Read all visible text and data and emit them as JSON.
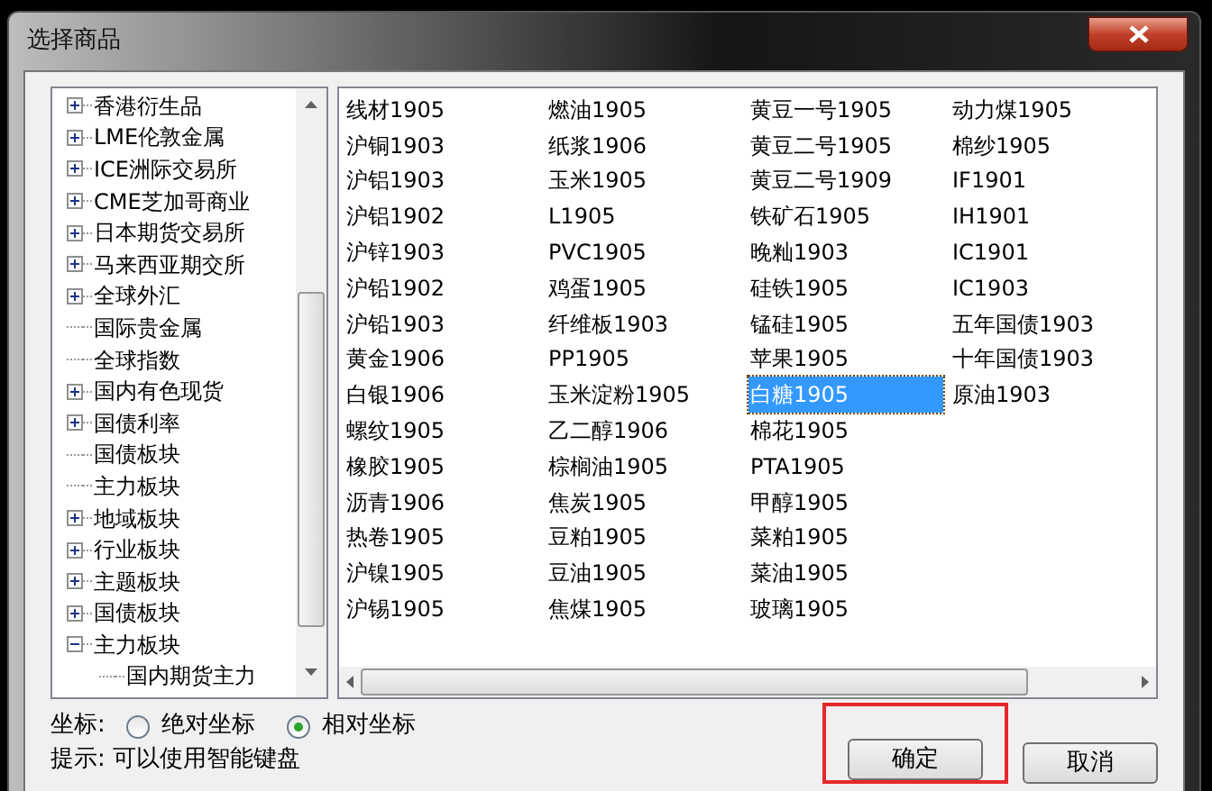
{
  "window": {
    "title": "选择商品"
  },
  "tree": [
    {
      "label": "香港衍生品",
      "kind": "group",
      "expanded": false
    },
    {
      "label": "LME伦敦金属",
      "kind": "group",
      "expanded": false
    },
    {
      "label": "ICE洲际交易所",
      "kind": "group",
      "expanded": false
    },
    {
      "label": "CME芝加哥商业",
      "kind": "group",
      "expanded": false
    },
    {
      "label": "日本期货交易所",
      "kind": "group",
      "expanded": false
    },
    {
      "label": "马来西亚期交所",
      "kind": "group",
      "expanded": false
    },
    {
      "label": "全球外汇",
      "kind": "group",
      "expanded": false
    },
    {
      "label": "国际贵金属",
      "kind": "leaf"
    },
    {
      "label": "全球指数",
      "kind": "leaf"
    },
    {
      "label": "国内有色现货",
      "kind": "group",
      "expanded": false
    },
    {
      "label": "国债利率",
      "kind": "group",
      "expanded": false
    },
    {
      "label": "国债板块",
      "kind": "leaf"
    },
    {
      "label": "主力板块",
      "kind": "leaf"
    },
    {
      "label": "地域板块",
      "kind": "group",
      "expanded": false
    },
    {
      "label": "行业板块",
      "kind": "group",
      "expanded": false
    },
    {
      "label": "主题板块",
      "kind": "group",
      "expanded": false
    },
    {
      "label": "国债板块",
      "kind": "group",
      "expanded": false
    },
    {
      "label": "主力板块",
      "kind": "group",
      "expanded": true,
      "children": [
        {
          "label": "国内期货主力",
          "kind": "leaf"
        }
      ]
    }
  ],
  "products": [
    [
      {
        "label": "线材1905",
        "selected": false
      },
      {
        "label": "沪铜1903",
        "selected": false
      },
      {
        "label": "沪铝1903",
        "selected": false
      },
      {
        "label": "沪铝1902",
        "selected": false
      },
      {
        "label": "沪锌1903",
        "selected": false
      },
      {
        "label": "沪铅1902",
        "selected": false
      },
      {
        "label": "沪铅1903",
        "selected": false
      },
      {
        "label": "黄金1906",
        "selected": false
      },
      {
        "label": "白银1906",
        "selected": false
      },
      {
        "label": "螺纹1905",
        "selected": false
      },
      {
        "label": "橡胶1905",
        "selected": false
      },
      {
        "label": "沥青1906",
        "selected": false
      },
      {
        "label": "热卷1905",
        "selected": false
      },
      {
        "label": "沪镍1905",
        "selected": false
      },
      {
        "label": "沪锡1905",
        "selected": false
      }
    ],
    [
      {
        "label": "燃油1905",
        "selected": false
      },
      {
        "label": "纸浆1906",
        "selected": false
      },
      {
        "label": "玉米1905",
        "selected": false
      },
      {
        "label": "L1905",
        "selected": false
      },
      {
        "label": "PVC1905",
        "selected": false
      },
      {
        "label": "鸡蛋1905",
        "selected": false
      },
      {
        "label": "纤维板1903",
        "selected": false
      },
      {
        "label": "PP1905",
        "selected": false
      },
      {
        "label": "玉米淀粉1905",
        "selected": false
      },
      {
        "label": "乙二醇1906",
        "selected": false
      },
      {
        "label": "棕榈油1905",
        "selected": false
      },
      {
        "label": "焦炭1905",
        "selected": false
      },
      {
        "label": "豆粕1905",
        "selected": false
      },
      {
        "label": "豆油1905",
        "selected": false
      },
      {
        "label": "焦煤1905",
        "selected": false
      }
    ],
    [
      {
        "label": "黄豆一号1905",
        "selected": false
      },
      {
        "label": "黄豆二号1905",
        "selected": false
      },
      {
        "label": "黄豆二号1909",
        "selected": false
      },
      {
        "label": "铁矿石1905",
        "selected": false
      },
      {
        "label": "晚籼1903",
        "selected": false
      },
      {
        "label": "硅铁1905",
        "selected": false
      },
      {
        "label": "锰硅1905",
        "selected": false
      },
      {
        "label": "苹果1905",
        "selected": false
      },
      {
        "label": "白糖1905",
        "selected": true
      },
      {
        "label": "棉花1905",
        "selected": false
      },
      {
        "label": "PTA1905",
        "selected": false
      },
      {
        "label": "甲醇1905",
        "selected": false
      },
      {
        "label": "菜粕1905",
        "selected": false
      },
      {
        "label": "菜油1905",
        "selected": false
      },
      {
        "label": "玻璃1905",
        "selected": false
      }
    ],
    [
      {
        "label": "动力煤1905",
        "selected": false
      },
      {
        "label": "棉纱1905",
        "selected": false
      },
      {
        "label": "IF1901",
        "selected": false
      },
      {
        "label": "IH1901",
        "selected": false
      },
      {
        "label": "IC1901",
        "selected": false
      },
      {
        "label": "IC1903",
        "selected": false
      },
      {
        "label": "五年国债1903",
        "selected": false
      },
      {
        "label": "十年国债1903",
        "selected": false
      },
      {
        "label": "原油1903",
        "selected": false
      }
    ]
  ],
  "coordinate": {
    "label": "坐标:",
    "options": [
      {
        "label": "绝对坐标",
        "selected": false
      },
      {
        "label": "相对坐标",
        "selected": true
      }
    ]
  },
  "hint": "提示: 可以使用智能键盘",
  "buttons": [
    {
      "label": "确定",
      "highlighted": true
    },
    {
      "label": "取消",
      "highlighted": false
    }
  ]
}
